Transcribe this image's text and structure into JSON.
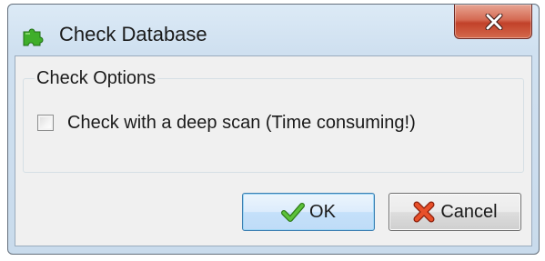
{
  "window": {
    "title": "Check Database",
    "app_icon": "puzzle-piece-icon",
    "close_icon": "close-icon"
  },
  "check_options": {
    "group_label": "Check Options",
    "deep_scan_label": "Check with a deep scan (Time consuming!)",
    "deep_scan_checked": false
  },
  "buttons": {
    "ok_label": "OK",
    "ok_icon": "checkmark-icon",
    "cancel_label": "Cancel",
    "cancel_icon": "x-mark-icon"
  },
  "colors": {
    "close_button": "#c9472f",
    "ok_border": "#3c7fb1",
    "check_icon": "#4fa52b",
    "cancel_icon": "#d8401e",
    "app_icon": "#3fae2a"
  }
}
